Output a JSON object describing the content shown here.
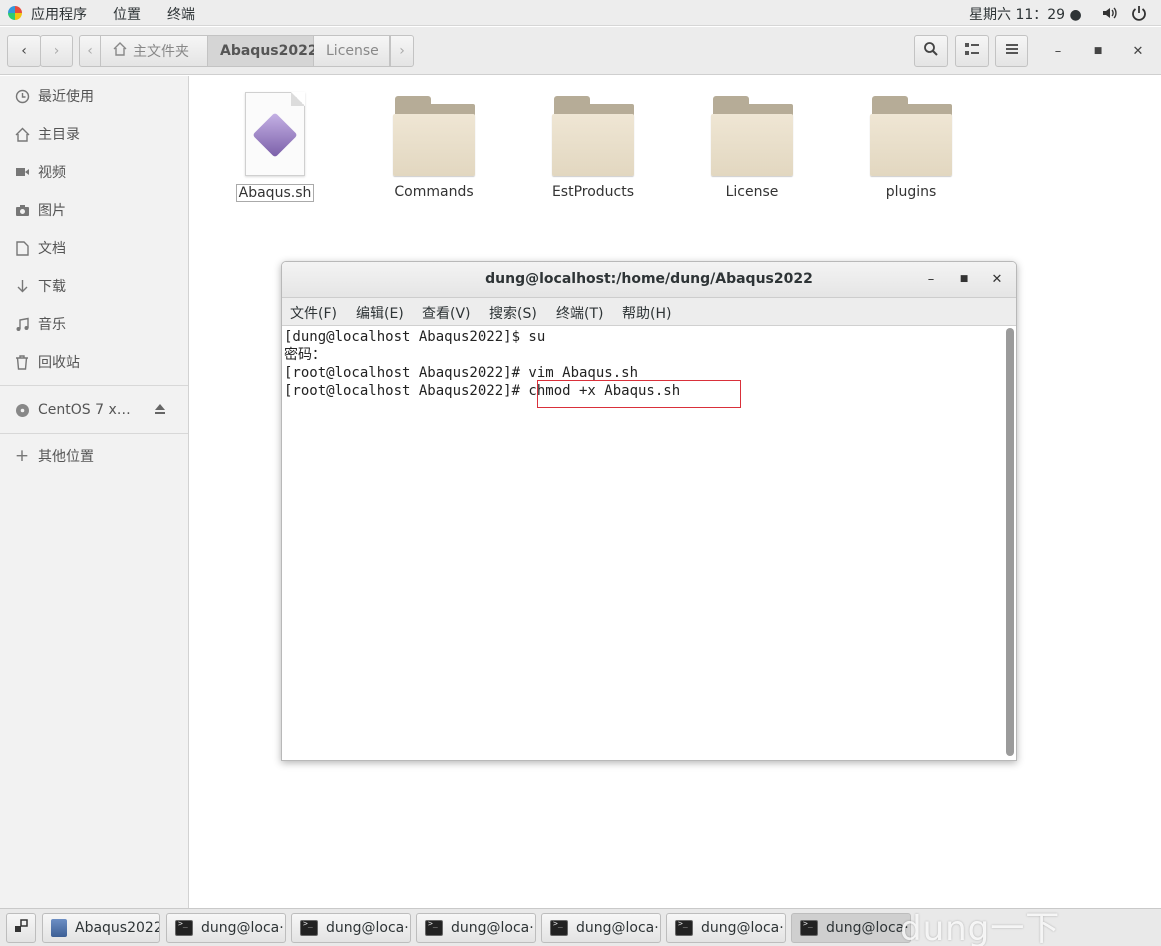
{
  "topbar": {
    "apps": "应用程序",
    "places": "位置",
    "terminal": "终端",
    "clock": "星期六 11：29 ●",
    "volume_icon": "volume-icon",
    "power_icon": "power-icon"
  },
  "headerbar": {
    "breadcrumbs": [
      "主文件夹",
      "Abaqus2022",
      "License"
    ],
    "active_crumb": "Abaqus2022"
  },
  "sidebar": {
    "items": [
      {
        "label": "最近使用",
        "icon": "clock-icon"
      },
      {
        "label": "主目录",
        "icon": "home-icon"
      },
      {
        "label": "视频",
        "icon": "video-icon"
      },
      {
        "label": "图片",
        "icon": "camera-icon"
      },
      {
        "label": "文档",
        "icon": "document-icon"
      },
      {
        "label": "下载",
        "icon": "download-icon"
      },
      {
        "label": "音乐",
        "icon": "music-icon"
      },
      {
        "label": "回收站",
        "icon": "trash-icon"
      }
    ],
    "device": {
      "label": "CentOS 7 x…",
      "icon": "disc-icon"
    },
    "other": {
      "label": "其他位置",
      "icon": "plus-icon"
    }
  },
  "files": [
    {
      "name": "Abaqus.sh",
      "type": "script"
    },
    {
      "name": "Commands",
      "type": "folder"
    },
    {
      "name": "EstProducts",
      "type": "folder"
    },
    {
      "name": "License",
      "type": "folder"
    },
    {
      "name": "plugins",
      "type": "folder"
    }
  ],
  "terminal": {
    "title": "dung@localhost:/home/dung/Abaqus2022",
    "menu": [
      "文件(F)",
      "编辑(E)",
      "查看(V)",
      "搜索(S)",
      "终端(T)",
      "帮助(H)"
    ],
    "lines": [
      "[dung@localhost Abaqus2022]$ su",
      "密码：",
      "[root@localhost Abaqus2022]# vim Abaqus.sh",
      "[root@localhost Abaqus2022]# chmod +x Abaqus.sh"
    ],
    "highlight_color": "#d9303a"
  },
  "taskbar": {
    "tasks": [
      "Abaqus2022",
      "dung@loca···",
      "dung@loca···",
      "dung@loca···",
      "dung@loca···",
      "dung@loca···",
      "dung@loca···"
    ],
    "active_index": 6
  },
  "watermark": "dung一下"
}
